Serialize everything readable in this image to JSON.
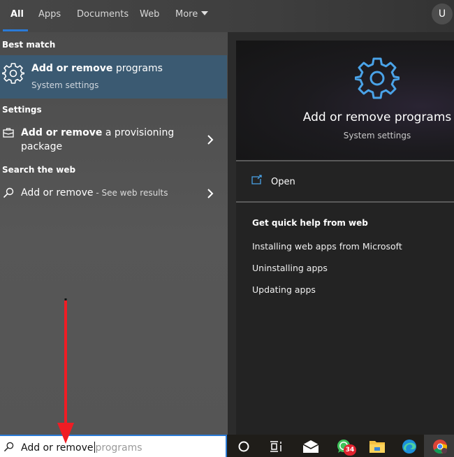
{
  "tabs": [
    {
      "label": "All",
      "active": true
    },
    {
      "label": "Apps"
    },
    {
      "label": "Documents"
    },
    {
      "label": "Web"
    },
    {
      "label": "More"
    }
  ],
  "user_avatar": {
    "initial": "U"
  },
  "left_pane": {
    "best_match": {
      "heading": "Best match",
      "title_bold": "Add or remove",
      "title_rest": " programs",
      "subtitle": "System settings",
      "icon": "gear-icon"
    },
    "settings": {
      "heading": "Settings",
      "items": [
        {
          "bold": "Add or remove",
          "rest": " a provisioning",
          "line2": "package",
          "icon": "briefcase-icon"
        }
      ]
    },
    "web": {
      "heading": "Search the web",
      "items": [
        {
          "text": "Add or remove",
          "suffix": " - See web results",
          "icon": "search-icon"
        }
      ]
    }
  },
  "right_pane": {
    "title": "Add or remove programs",
    "subtitle": "System settings",
    "open_label": "Open",
    "help_heading": "Get quick help from web",
    "help_links": [
      "Installing web apps from Microsoft",
      "Uninstalling apps",
      "Updating apps"
    ]
  },
  "search": {
    "typed": "Add or remove",
    "completion": "programs"
  },
  "taskbar": {
    "items": [
      {
        "name": "cortana"
      },
      {
        "name": "task-view"
      },
      {
        "name": "mail"
      },
      {
        "name": "whatsapp",
        "badge": "34"
      },
      {
        "name": "file-explorer"
      },
      {
        "name": "edge"
      },
      {
        "name": "chrome"
      }
    ]
  },
  "colors": {
    "accent": "#2b7ad6",
    "selection": "#3b5a72",
    "gear_blue": "#4aa3e8",
    "annotation_arrow": "#f01c24",
    "badge_red": "#e0222e"
  }
}
